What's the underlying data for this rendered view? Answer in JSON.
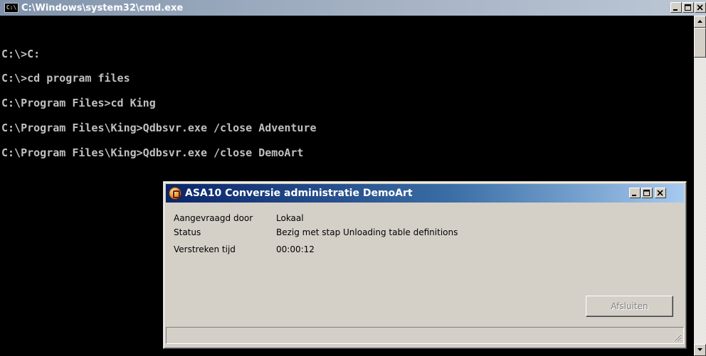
{
  "cmd_window": {
    "title": "C:\\Windows\\system32\\cmd.exe",
    "icon_text": "C:\\",
    "lines": [
      "C:\\>C:",
      "C:\\>cd program files",
      "C:\\Program Files>cd King",
      "C:\\Program Files\\King>Qdbsvr.exe /close Adventure",
      "C:\\Program Files\\King>Qdbsvr.exe /close DemoArt"
    ]
  },
  "dialog": {
    "title": "ASA10 Conversie administratie DemoArt",
    "rows": [
      {
        "label": "Aangevraagd door",
        "value": "Lokaal"
      },
      {
        "label": "Status",
        "value": "Bezig met stap Unloading table definitions"
      },
      {
        "label": "Verstreken tijd",
        "value": "00:00:12"
      }
    ],
    "close_button_label": "Afsluiten",
    "close_button_enabled": false
  },
  "colors": {
    "console_background": "#000000",
    "console_text": "#c0c0c0",
    "dialog_titlebar_start": "#0a246a",
    "dialog_titlebar_end": "#a6caf0",
    "face": "#d4d0c8"
  },
  "icons": {
    "cmd": "cmd-app-icon",
    "dialog": "asa-app-icon",
    "minimize": "minimize-icon",
    "maximize": "maximize-icon",
    "close": "close-icon",
    "scroll_up": "arrow-up-icon",
    "scroll_down": "arrow-down-icon",
    "resize_grip": "resize-grip-icon"
  }
}
